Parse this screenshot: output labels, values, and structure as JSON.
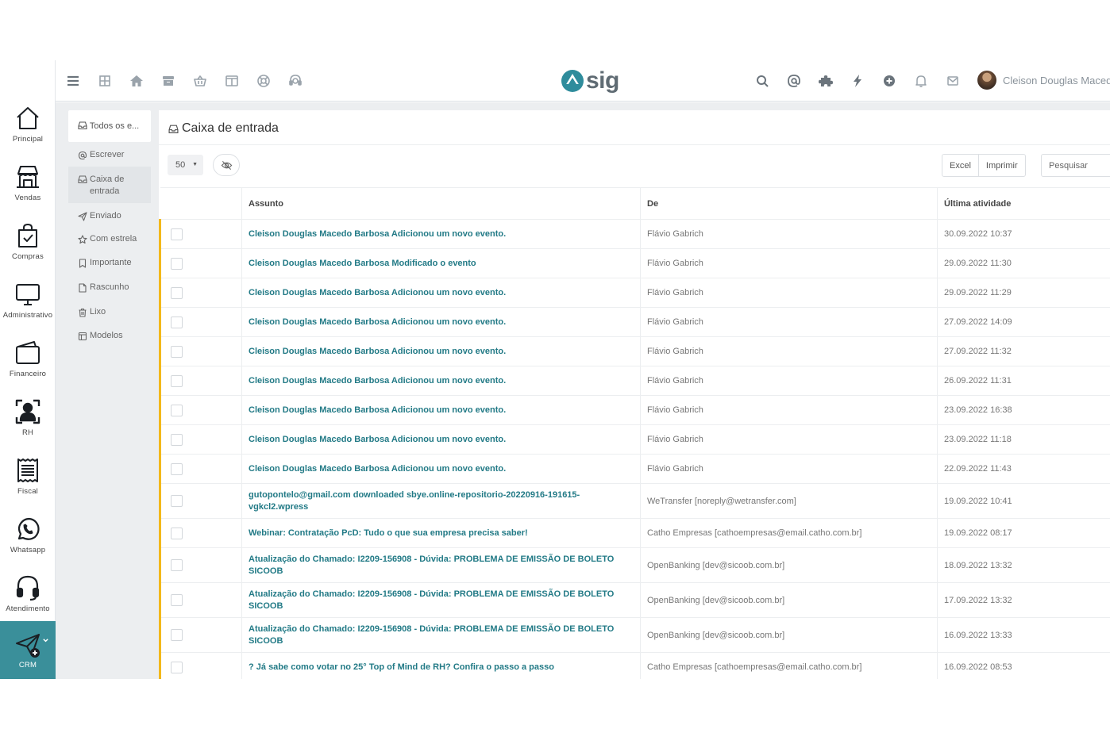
{
  "modules": [
    {
      "label": "Principal",
      "icon": "house-icon"
    },
    {
      "label": "Vendas",
      "icon": "store-icon"
    },
    {
      "label": "Compras",
      "icon": "shopping-bag-icon"
    },
    {
      "label": "Administrativo",
      "icon": "monitor-icon"
    },
    {
      "label": "Financeiro",
      "icon": "wallet-icon"
    },
    {
      "label": "RH",
      "icon": "person-scan-icon"
    },
    {
      "label": "Fiscal",
      "icon": "receipt-icon"
    },
    {
      "label": "Whatsapp",
      "icon": "whatsapp-icon"
    },
    {
      "label": "Atendimento",
      "icon": "headset-icon"
    },
    {
      "label": "CRM",
      "icon": "send-plus-icon",
      "active": true
    }
  ],
  "topbar": {
    "left_icons": [
      "menu-icon",
      "grid-icon",
      "home-icon",
      "archive-icon",
      "basket-icon",
      "columns-icon",
      "lifebuoy-icon",
      "support-icon"
    ],
    "right_icons": [
      "search-icon",
      "at-icon",
      "puzzle-icon",
      "bolt-icon",
      "add-circle-icon",
      "bell-icon",
      "mail-icon"
    ],
    "logo_text": "sig",
    "user_name": "Cleison Douglas Macedo Barbosa"
  },
  "folders": {
    "all": "Todos os e...",
    "items": [
      {
        "label": "Escrever",
        "icon": "at-icon"
      },
      {
        "label": "Caixa de entrada",
        "icon": "inbox-icon",
        "selected": true
      },
      {
        "label": "Enviado",
        "icon": "send-icon"
      },
      {
        "label": "Com estrela",
        "icon": "star-icon"
      },
      {
        "label": "Importante",
        "icon": "bookmark-icon"
      },
      {
        "label": "Rascunho",
        "icon": "file-icon"
      },
      {
        "label": "Lixo",
        "icon": "trash-icon"
      },
      {
        "label": "Modelos",
        "icon": "template-icon"
      }
    ]
  },
  "panel": {
    "title": "Caixa de entrada",
    "page_size": "50",
    "buttons": {
      "excel": "Excel",
      "print": "Imprimir"
    },
    "search_placeholder": "Pesquisar"
  },
  "table": {
    "columns": [
      "Assunto",
      "De",
      "Última atividade"
    ],
    "rows": [
      {
        "subject": "Cleison Douglas Macedo Barbosa Adicionou um novo evento.",
        "from": "Flávio Gabrich",
        "date": "30.09.2022 10:37"
      },
      {
        "subject": "Cleison Douglas Macedo Barbosa Modificado o evento",
        "from": "Flávio Gabrich",
        "date": "29.09.2022 11:30"
      },
      {
        "subject": "Cleison Douglas Macedo Barbosa Adicionou um novo evento.",
        "from": "Flávio Gabrich",
        "date": "29.09.2022 11:29"
      },
      {
        "subject": "Cleison Douglas Macedo Barbosa Adicionou um novo evento.",
        "from": "Flávio Gabrich",
        "date": "27.09.2022 14:09"
      },
      {
        "subject": "Cleison Douglas Macedo Barbosa Adicionou um novo evento.",
        "from": "Flávio Gabrich",
        "date": "27.09.2022 11:32"
      },
      {
        "subject": "Cleison Douglas Macedo Barbosa Adicionou um novo evento.",
        "from": "Flávio Gabrich",
        "date": "26.09.2022 11:31"
      },
      {
        "subject": "Cleison Douglas Macedo Barbosa Adicionou um novo evento.",
        "from": "Flávio Gabrich",
        "date": "23.09.2022 16:38"
      },
      {
        "subject": "Cleison Douglas Macedo Barbosa Adicionou um novo evento.",
        "from": "Flávio Gabrich",
        "date": "23.09.2022 11:18"
      },
      {
        "subject": "Cleison Douglas Macedo Barbosa Adicionou um novo evento.",
        "from": "Flávio Gabrich",
        "date": "22.09.2022 11:43"
      },
      {
        "subject": "gutopontelo@gmail.com downloaded sbye.online-repositorio-20220916-191615-vgkcl2.wpress",
        "from": "WeTransfer [noreply@wetransfer.com]",
        "date": "19.09.2022 10:41"
      },
      {
        "subject": "Webinar: Contratação PcD: Tudo o que sua empresa precisa saber!",
        "from": "Catho Empresas [cathoempresas@email.catho.com.br]",
        "date": "19.09.2022 08:17"
      },
      {
        "subject": "Atualização do Chamado: I2209-156908 - Dúvida: PROBLEMA DE EMISSÃO DE BOLETO SICOOB",
        "from": "OpenBanking [dev@sicoob.com.br]",
        "date": "18.09.2022 13:32"
      },
      {
        "subject": "Atualização do Chamado: I2209-156908 - Dúvida: PROBLEMA DE EMISSÃO DE BOLETO SICOOB",
        "from": "OpenBanking [dev@sicoob.com.br]",
        "date": "17.09.2022 13:32"
      },
      {
        "subject": "Atualização do Chamado: I2209-156908 - Dúvida: PROBLEMA DE EMISSÃO DE BOLETO SICOOB",
        "from": "OpenBanking [dev@sicoob.com.br]",
        "date": "16.09.2022 13:33"
      },
      {
        "subject": "? Já sabe como votar no 25° Top of Mind de RH? Confira o passo a passo",
        "from": "Catho Empresas [cathoempresas@email.catho.com.br]",
        "date": "16.09.2022 08:53"
      }
    ]
  },
  "colors": {
    "accent": "#227a86",
    "crm_active": "#3a8f9a",
    "unread_bar": "#f3b81b",
    "logo": "#2f8c9c"
  }
}
